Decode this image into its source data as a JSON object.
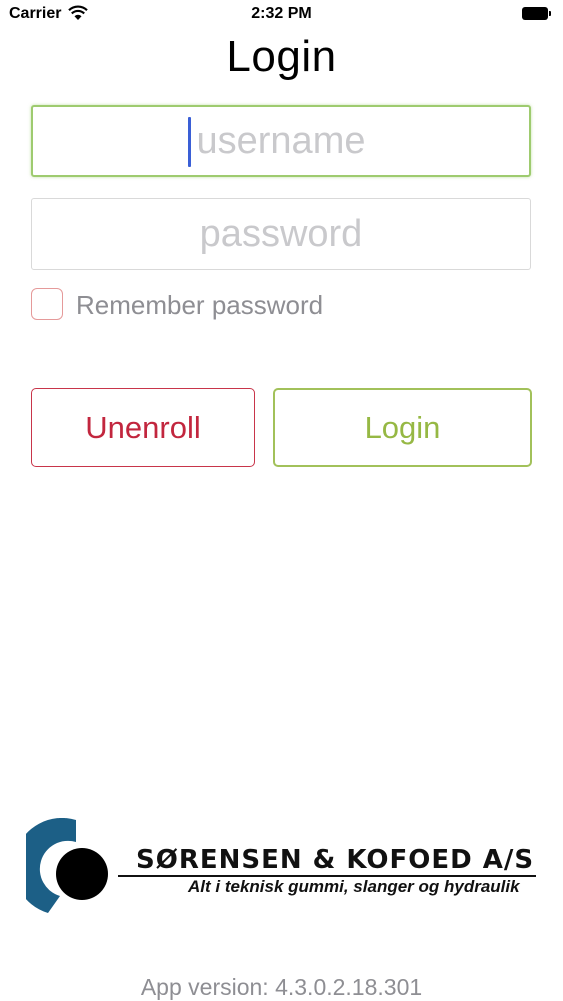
{
  "status_bar": {
    "carrier": "Carrier",
    "time": "2:32 PM",
    "icons": [
      "wifi-icon",
      "battery-icon"
    ]
  },
  "title": "Login",
  "form": {
    "username": {
      "value": "",
      "placeholder": "username",
      "focused": true
    },
    "password": {
      "value": "",
      "placeholder": "password"
    },
    "remember": {
      "label": "Remember password",
      "checked": false
    }
  },
  "buttons": {
    "unenroll": "Unenroll",
    "login": "Login"
  },
  "logo": {
    "company": "SØRENSEN & KOFOED A/S",
    "tagline": "Alt i teknisk gummi, slanger og hydraulik"
  },
  "footer": {
    "version": "App version: 4.3.0.2.18.301"
  },
  "colors": {
    "focus_border": "#9ecb6f",
    "caret": "#3a5fd6",
    "unenroll": "#c2263e",
    "login": "#96b844",
    "checkbox_border": "#e59a9a",
    "logo_blue": "#1c5f86"
  }
}
